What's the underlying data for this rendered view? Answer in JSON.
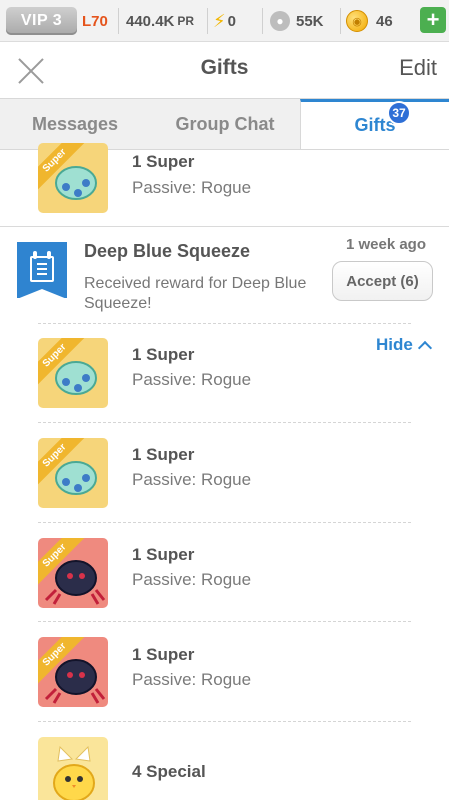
{
  "status_bar": {
    "vip": "VIP 3",
    "level": "L70",
    "power_value": "440.4K",
    "power_unit": "PR",
    "energy": "0",
    "paws": "55K",
    "coins": "46",
    "add": "+"
  },
  "nav": {
    "title": "Gifts",
    "edit": "Edit"
  },
  "tabs": [
    {
      "label": "Messages",
      "selected": false
    },
    {
      "label": "Group Chat",
      "selected": false
    },
    {
      "label": "Gifts",
      "selected": true,
      "badge": "37"
    }
  ],
  "top_item": {
    "ribbon": "Super",
    "title": "1 Super",
    "subtitle": "Passive: Rogue"
  },
  "message": {
    "title": "Deep Blue Squeeze",
    "time": "1 week ago",
    "body": "Received reward for Deep Blue Squeeze!",
    "accept_label": "Accept (6)",
    "hide_label": "Hide"
  },
  "gifts": [
    {
      "ribbon": "Super",
      "title": "1 Super",
      "subtitle": "Passive: Rogue",
      "pet": "teal-dragon"
    },
    {
      "ribbon": "Super",
      "title": "1 Super",
      "subtitle": "Passive: Rogue",
      "pet": "teal-dragon"
    },
    {
      "ribbon": "Super",
      "title": "1 Super",
      "subtitle": "Passive: Rogue",
      "pet": "dark-spider"
    },
    {
      "ribbon": "Super",
      "title": "1 Super",
      "subtitle": "Passive: Rogue",
      "pet": "dark-spider"
    },
    {
      "ribbon": "",
      "title": "4 Special",
      "subtitle": "",
      "pet": "yellow-chick"
    }
  ],
  "colors": {
    "accent": "#2e86d1",
    "badge": "#2e6fd6",
    "level": "#e5541c",
    "add": "#4caf50"
  }
}
